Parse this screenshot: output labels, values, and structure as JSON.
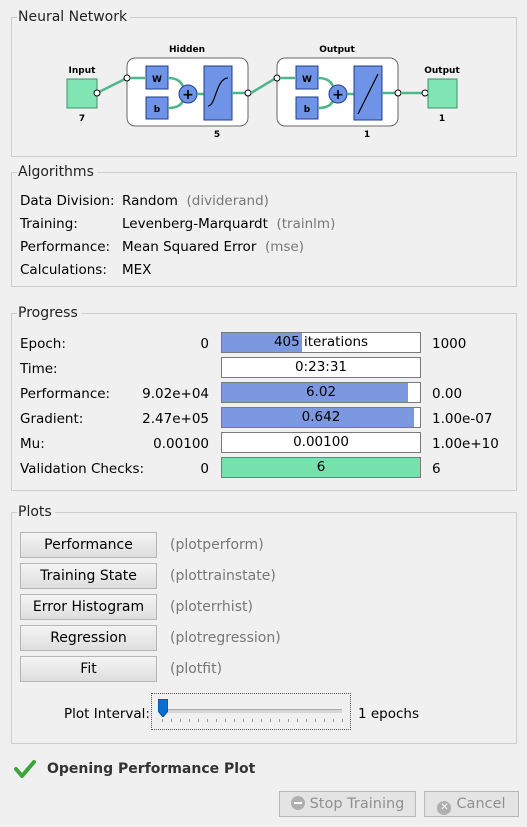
{
  "neural_network": {
    "title": "Neural Network",
    "input_label": "Input",
    "input_size": "7",
    "hidden_label": "Hidden",
    "hidden_size": "5",
    "output_layer_label": "Output",
    "output_layer_size": "1",
    "output_label": "Output",
    "output_size": "1",
    "w": "W",
    "b": "b"
  },
  "algorithms": {
    "title": "Algorithms",
    "rows": [
      {
        "label": "Data Division:",
        "value": "Random",
        "fn": "(dividerand)"
      },
      {
        "label": "Training:",
        "value": "Levenberg-Marquardt",
        "fn": "(trainlm)"
      },
      {
        "label": "Performance:",
        "value": "Mean Squared Error",
        "fn": "(mse)"
      },
      {
        "label": "Calculations:",
        "value": "MEX",
        "fn": ""
      }
    ]
  },
  "progress": {
    "title": "Progress",
    "rows": [
      {
        "label": "Epoch:",
        "start": "0",
        "text": "405 iterations",
        "end": "1000",
        "fill": 0.405,
        "color": "#7b98e0"
      },
      {
        "label": "Time:",
        "start": "",
        "text": "0:23:31",
        "end": "",
        "fill": 0,
        "color": "#7b98e0"
      },
      {
        "label": "Performance:",
        "start": "9.02e+04",
        "text": "6.02",
        "end": "0.00",
        "fill": 0.94,
        "color": "#7b98e0"
      },
      {
        "label": "Gradient:",
        "start": "2.47e+05",
        "text": "0.642",
        "end": "1.00e-07",
        "fill": 0.97,
        "color": "#7b98e0"
      },
      {
        "label": "Mu:",
        "start": "0.00100",
        "text": "0.00100",
        "end": "1.00e+10",
        "fill": 0,
        "color": "#7b98e0"
      },
      {
        "label": "Validation Checks:",
        "start": "0",
        "text": "6",
        "end": "6",
        "fill": 1.0,
        "color": "#76e1ad"
      }
    ]
  },
  "plots": {
    "title": "Plots",
    "buttons": [
      {
        "label": "Performance",
        "fn": "(plotperform)"
      },
      {
        "label": "Training State",
        "fn": "(plottrainstate)"
      },
      {
        "label": "Error Histogram",
        "fn": "(ploterrhist)"
      },
      {
        "label": "Regression",
        "fn": "(plotregression)"
      },
      {
        "label": "Fit",
        "fn": "(plotfit)"
      }
    ],
    "interval_label": "Plot Interval:",
    "interval_value": "1 epochs",
    "interval_slider_fraction": 0
  },
  "status": {
    "text": "Opening Performance Plot",
    "icon": "checkmark-icon"
  },
  "footer": {
    "stop_label": "Stop Training",
    "cancel_label": "Cancel",
    "stop_icon": "stop-icon",
    "cancel_icon": "cancel-icon"
  }
}
